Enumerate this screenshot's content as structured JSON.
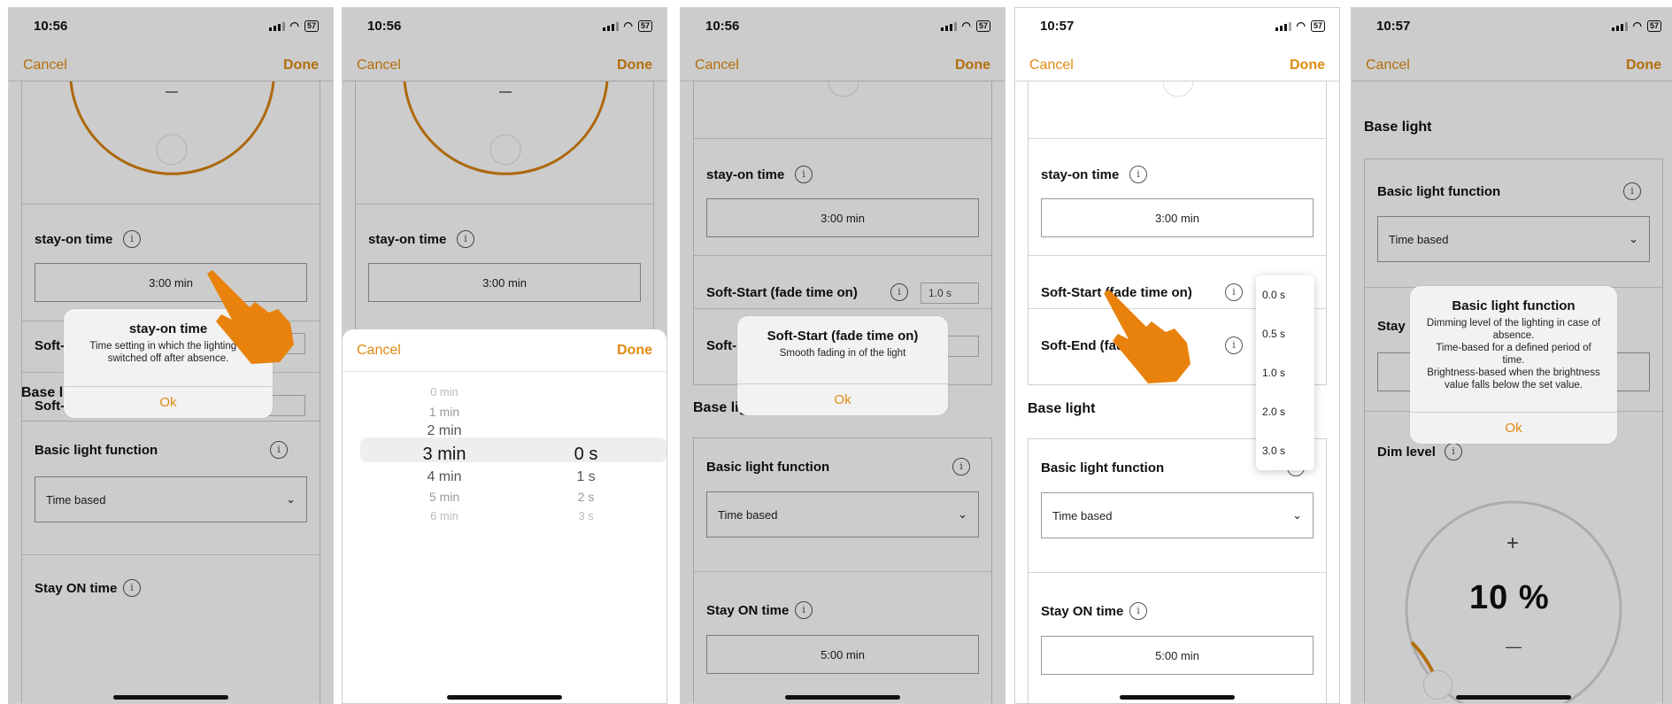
{
  "colors": {
    "accent": "#e08a10",
    "text": "#111111",
    "border": "#cfcfcf"
  },
  "screens": [
    {
      "time": "10:56",
      "battery": "57",
      "nav": {
        "cancel": "Cancel",
        "done": "Done"
      },
      "stay_on": {
        "label": "stay-on time",
        "value": "3:00 min"
      },
      "soft_start_partial": "Soft-S",
      "soft_end_partial": "Soft-E",
      "base_light": "Base light",
      "basic_light_function": {
        "label": "Basic light function",
        "value": "Time based"
      },
      "stay_on_time2": "Stay ON time",
      "alert": {
        "title": "stay-on time",
        "message": "Time setting in which the lighting is switched off after absence.",
        "ok": "Ok"
      },
      "info_icon": "i"
    },
    {
      "time": "10:56",
      "battery": "57",
      "nav": {
        "cancel": "Cancel",
        "done": "Done"
      },
      "stay_on": {
        "label": "stay-on time",
        "value": "3:00 min"
      },
      "sheet": {
        "cancel": "Cancel",
        "done": "Done"
      },
      "picker_minutes": [
        "0 min",
        "1 min",
        "2 min",
        "3 min",
        "4 min",
        "5 min",
        "6 min"
      ],
      "picker_seconds": [
        "0 s",
        "1 s",
        "2 s",
        "3 s"
      ],
      "info_icon": "i"
    },
    {
      "time": "10:56",
      "battery": "57",
      "nav": {
        "cancel": "Cancel",
        "done": "Done"
      },
      "stay_on": {
        "label": "stay-on time",
        "value": "3:00 min"
      },
      "soft_start": {
        "label": "Soft-Start (fade time on)",
        "value": "1.0 s"
      },
      "soft_end_partial": "Soft-E",
      "base_light_partial": "Base lig",
      "basic_light_function": {
        "label": "Basic light function",
        "value": "Time based"
      },
      "stay_on_time2": {
        "label": "Stay ON time",
        "value": "5:00 min"
      },
      "alert": {
        "title": "Soft-Start (fade time on)",
        "message": "Smooth fading in of the light",
        "ok": "Ok"
      },
      "info_icon": "i"
    },
    {
      "time": "10:57",
      "battery": "57",
      "nav": {
        "cancel": "Cancel",
        "done": "Done"
      },
      "stay_on": {
        "label": "stay-on time",
        "value": "3:00 min"
      },
      "soft_start": {
        "label": "Soft-Start (fade time on)"
      },
      "soft_end_partial": "Soft-End (fad",
      "base_light": "Base light",
      "basic_light_function": {
        "label": "Basic light function",
        "value": "Time based"
      },
      "stay_on_time2": {
        "label": "Stay ON time",
        "value": "5:00 min"
      },
      "dropdown_options": [
        "0.0 s",
        "0.5 s",
        "1.0 s",
        "2.0 s",
        "3.0 s"
      ],
      "info_icon": "i"
    },
    {
      "time": "10:57",
      "battery": "57",
      "nav": {
        "cancel": "Cancel",
        "done": "Done"
      },
      "base_light": "Base light",
      "basic_light_function": {
        "label": "Basic light function",
        "value": "Time based"
      },
      "stay_partial": "Stay",
      "dim_level": {
        "label": "Dim level",
        "value": "10 %",
        "plus": "+",
        "minus": "—",
        "level": 0.1
      },
      "alert": {
        "title": "Basic light function",
        "message": "Dimming level of the lighting in case of absence.\nTime-based for a defined period of time.\nBrightness-based when the brightness value falls below the set value.",
        "ok": "Ok"
      },
      "info_icon": "i"
    }
  ]
}
